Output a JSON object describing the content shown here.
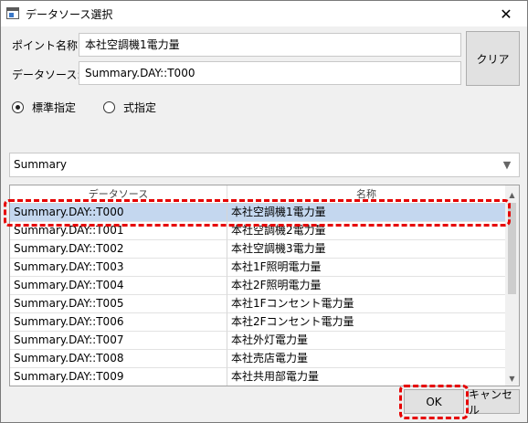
{
  "window": {
    "title": "データソース選択",
    "close_glyph": "✕"
  },
  "form": {
    "point_name_label": "ポイント名称:",
    "point_name_value": "本社空調機1電力量",
    "data_source_label": "データソース:",
    "data_source_value": "Summary.DAY::T000",
    "clear_button": "クリア"
  },
  "mode": {
    "standard_label": "標準指定",
    "formula_label": "式指定",
    "selected": "standard"
  },
  "source_select": {
    "value": "Summary",
    "arrow": "▼"
  },
  "grid": {
    "headers": [
      "データソース",
      "名称"
    ],
    "rows": [
      {
        "source": "Summary.DAY::T000",
        "name": "本社空調機1電力量",
        "selected": true
      },
      {
        "source": "Summary.DAY::T001",
        "name": "本社空調機2電力量"
      },
      {
        "source": "Summary.DAY::T002",
        "name": "本社空調機3電力量"
      },
      {
        "source": "Summary.DAY::T003",
        "name": "本社1F照明電力量"
      },
      {
        "source": "Summary.DAY::T004",
        "name": "本社2F照明電力量"
      },
      {
        "source": "Summary.DAY::T005",
        "name": "本社1Fコンセント電力量"
      },
      {
        "source": "Summary.DAY::T006",
        "name": "本社2Fコンセント電力量"
      },
      {
        "source": "Summary.DAY::T007",
        "name": "本社外灯電力量"
      },
      {
        "source": "Summary.DAY::T008",
        "name": "本社売店電力量"
      },
      {
        "source": "Summary.DAY::T009",
        "name": "本社共用部電力量"
      }
    ],
    "scroll_up_glyph": "▲",
    "scroll_down_glyph": "▼"
  },
  "buttons": {
    "ok": "OK",
    "cancel": "キャンセル"
  },
  "colors": {
    "selection": "#c4d7ef",
    "annotation": "#e60000"
  }
}
